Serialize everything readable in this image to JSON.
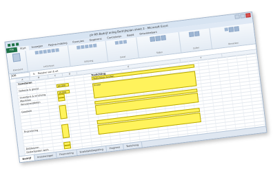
{
  "window": {
    "title": "ph-RFi-Bedrijf anlog Bedrijfsplan sheet 2 - Microsoft Excel"
  },
  "tabs": [
    "File",
    "Start",
    "Invoegen",
    "Pagina-indeling",
    "Formules",
    "Gegevens",
    "Controleren",
    "Beeld",
    "Ontwikkelaars"
  ],
  "ribbon": {
    "groups": [
      "Klembord",
      "Lettertype",
      "Uitlijning",
      "Getal",
      "Stijlen",
      "Cellen",
      "Bewerken"
    ]
  },
  "formula_bar": {
    "cell_ref": "A36",
    "value": "Rooster van 6 uit"
  },
  "sheet": {
    "section_left": "Investeren",
    "section_right": "Toelichting",
    "rows": [
      {
        "label": "Gebouw & grond",
        "value": "60.000",
        "note": "Toelichting invullen"
      },
      {
        "label": "Inventaris & inrichting",
        "value": "15.000",
        "note": "Invoer"
      },
      {
        "label": "Machines",
        "value": "",
        "note": ""
      },
      {
        "label": "Vervoermiddelen",
        "value": "",
        "note": ""
      },
      {
        "label": "Goodwill",
        "value": "",
        "note": ""
      },
      {
        "label": "Voorraad",
        "value": "",
        "note": ""
      },
      {
        "label": "Debiteuren",
        "value": "",
        "note": ""
      },
      {
        "label": "Onderhanden werk",
        "value": "",
        "note": ""
      }
    ],
    "middle_label": "Financiering",
    "bottom_left": "Totaal",
    "bottom_value": "Rooster",
    "bottom_note": "Toelichting"
  },
  "sheet_tabs": [
    "Bedrijf",
    "Investeringen",
    "Financiering",
    "Exploitatiebegroting",
    "Prognose",
    "Toelichting"
  ]
}
